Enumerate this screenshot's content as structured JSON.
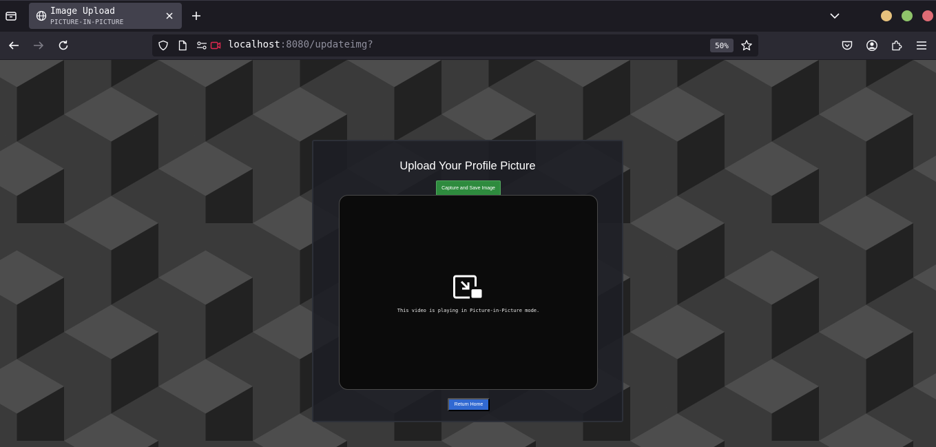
{
  "browser": {
    "tab": {
      "title": "Image Upload",
      "subtitle": "PICTURE-IN-PICTURE"
    },
    "url": {
      "host": "localhost",
      "path": ":8080/updateimg?"
    },
    "zoom": "50%",
    "window_controls": {
      "minimize_color": "#e6c17d",
      "maximize_color": "#8fc46a",
      "close_color": "#e06c75"
    },
    "icons": [
      "list-all-tabs-icon",
      "globe-icon",
      "close-icon",
      "plus-icon",
      "chevron-down-icon",
      "back-arrow-icon",
      "forward-arrow-icon",
      "reload-icon",
      "shield-icon",
      "page-icon",
      "permissions-icon",
      "camera-sharing-icon",
      "star-icon",
      "pocket-icon",
      "account-icon",
      "extensions-icon",
      "hamburger-menu-icon"
    ]
  },
  "page": {
    "heading": "Upload Your Profile Picture",
    "capture_button": "Capture and Save Image",
    "video": {
      "pip_message": "This video is playing in Picture-in-Picture mode.",
      "icon": "picture-in-picture-icon"
    },
    "return_button": "Return Home",
    "colors": {
      "capture_button": "#2e8b3e",
      "return_button": "#3169d2",
      "cube_light": "#4d4d4d",
      "cube_mid": "#3a3a3a",
      "cube_dark": "#222222"
    }
  }
}
